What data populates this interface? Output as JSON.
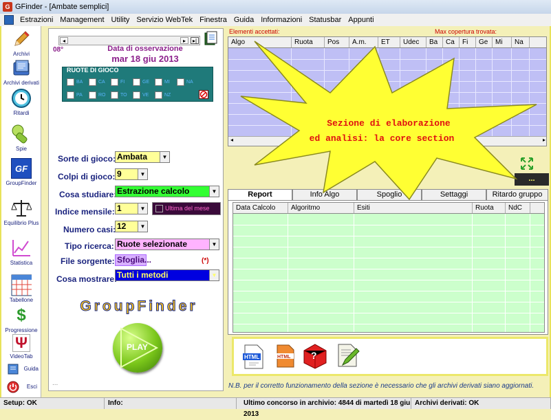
{
  "window": {
    "title": "GFinder - [Ambate semplici]"
  },
  "menu": [
    "Estrazioni",
    "Management",
    "Utility",
    "Servizio WebTek",
    "Finestra",
    "Guida",
    "Informazioni",
    "Statusbar",
    "Appunti"
  ],
  "sidebar": [
    {
      "label": "Archivi"
    },
    {
      "label": "Archivi derivati"
    },
    {
      "label": "Ritardi"
    },
    {
      "label": "Spie"
    },
    {
      "label": "GroupFinder"
    },
    {
      "label": "Equilibrio Plus"
    },
    {
      "label": "Statistica"
    },
    {
      "label": "Tabellone"
    },
    {
      "label": "Progressione"
    },
    {
      "label": "VideoTab"
    },
    {
      "label": "Guida"
    },
    {
      "label": "Esci"
    }
  ],
  "left": {
    "day_num": "08°",
    "obs_label": "Data di osservazione",
    "obs_date": "mar 18 giu 2013",
    "ruote_title": "RUOTE DI GIOCO",
    "ruote_row1": [
      "BA",
      "CA",
      "FI",
      "GE",
      "MI",
      "NA"
    ],
    "ruote_row2": [
      "PA",
      "RO",
      "TO",
      "VE",
      "NZ"
    ],
    "fields": {
      "sorte_label": "Sorte di gioco:",
      "sorte_value": "Ambata",
      "colpi_label": "Colpi di gioco:",
      "colpi_value": "9",
      "studiare_label": "Cosa studiare:",
      "studiare_value": "Estrazione calcolo",
      "indice_label": "Indice mensile:",
      "indice_value": "1",
      "ultima_label": "Ultima del mese",
      "casi_label": "Numero casi:",
      "casi_value": "12",
      "ricerca_label": "Tipo ricerca:",
      "ricerca_value": "Ruote selezionate",
      "file_label": "File sorgente:",
      "file_value": "Sfoglia...",
      "file_note": "(*)",
      "mostrare_label": "Cosa mostrare:",
      "mostrare_value": "Tutti i metodi"
    },
    "logo": "GroupFinder",
    "play": "PLAY",
    "ellipsis": "..."
  },
  "right": {
    "accepted_label": "Elementi accettati:",
    "max_label": "Max copertura trovata:",
    "top_columns": [
      "Algo",
      "Ruota",
      "Pos",
      "A.m.",
      "ET",
      "Udec",
      "Ba",
      "Ca",
      "Fi",
      "Ge",
      "Mi",
      "Na"
    ],
    "dots_button": "...",
    "tabs": [
      "Report",
      "Info Algo",
      "Spoglio",
      "Settaggi",
      "Ritardo gruppo"
    ],
    "bottom_columns": [
      "Data Calcolo",
      "Algoritmo",
      "Esiti",
      "Ruota",
      "NdC"
    ],
    "note": "N.B. per il corretto funzionamento della sezione è necessario che gli archivi derivati siano aggiornati.",
    "star_line1": "Sezione di elaborazione",
    "star_line2": "ed analisi: la core section"
  },
  "status": {
    "setup": "Setup: OK",
    "info": "Info:",
    "ultimo": "Ultimo concorso in archivio: 4844 di martedì 18 giu 2013",
    "derivati": "Archivi derivati: OK"
  },
  "colors": {
    "accent_purple": "#8b1f8b",
    "field_yellow": "#ffff99",
    "field_green": "#33ff33",
    "field_pink": "#ffb3ff",
    "field_blue": "#0000e0",
    "grid_blue": "#bfbff5",
    "grid_green": "#ccffcc",
    "star": "#ffff33"
  }
}
